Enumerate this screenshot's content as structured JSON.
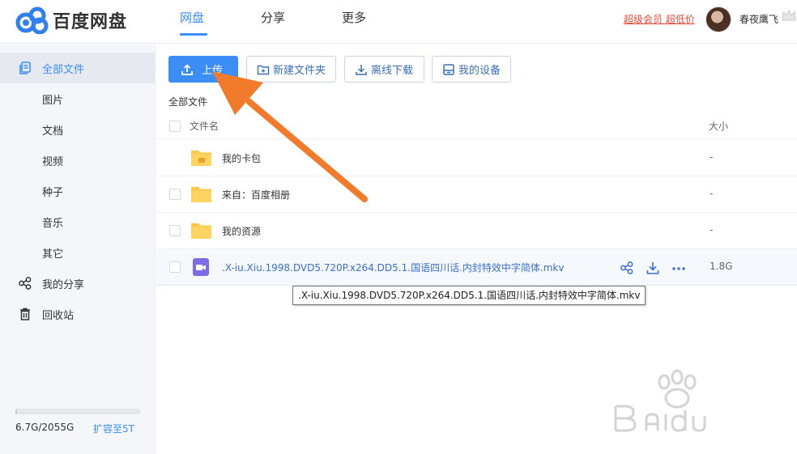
{
  "header": {
    "logo_text": "百度网盘",
    "nav": [
      {
        "label": "网盘",
        "active": true
      },
      {
        "label": "分享",
        "active": false
      },
      {
        "label": "更多",
        "active": false
      }
    ],
    "vip_link": "超级会员 超低价",
    "username": "春夜鹰飞"
  },
  "sidebar": {
    "items": [
      {
        "label": "全部文件",
        "icon": "all-files-icon",
        "active": true
      },
      {
        "label": "图片"
      },
      {
        "label": "文档"
      },
      {
        "label": "视频"
      },
      {
        "label": "种子"
      },
      {
        "label": "音乐"
      },
      {
        "label": "其它"
      },
      {
        "label": "我的分享",
        "icon": "share-icon"
      },
      {
        "label": "回收站",
        "icon": "trash-icon"
      }
    ],
    "quota": {
      "used_text": "6.7G/2055G",
      "used_fraction": 0.003,
      "expand_label": "扩容至5T"
    }
  },
  "toolbar": {
    "upload_label": "上传",
    "new_folder_label": "新建文件夹",
    "offline_download_label": "离线下载",
    "my_devices_label": "我的设备"
  },
  "breadcrumb": "全部文件",
  "list": {
    "col_name": "文件名",
    "col_size": "大小",
    "rows": [
      {
        "name": "我的卡包",
        "size": "-",
        "type": "folder-card"
      },
      {
        "name": "来自：百度相册",
        "size": "-",
        "type": "folder"
      },
      {
        "name": "我的资源",
        "size": "-",
        "type": "folder"
      },
      {
        "name": ".X-iu.Xiu.1998.DVD5.720P.x264.DD5.1.国语四川话.内封特效中字简体.mkv",
        "size": "1.8G",
        "type": "video"
      }
    ]
  },
  "tooltip": ".X-iu.Xiu.1998.DVD5.720P.x264.DD5.1.国语四川话.内封特效中字简体.mkv",
  "colors": {
    "accent": "#3a8ef6",
    "vip": "#e14d3a",
    "folder": "#fcc94b",
    "video": "#7e6ce6",
    "annotation_arrow": "#f27a2b"
  }
}
